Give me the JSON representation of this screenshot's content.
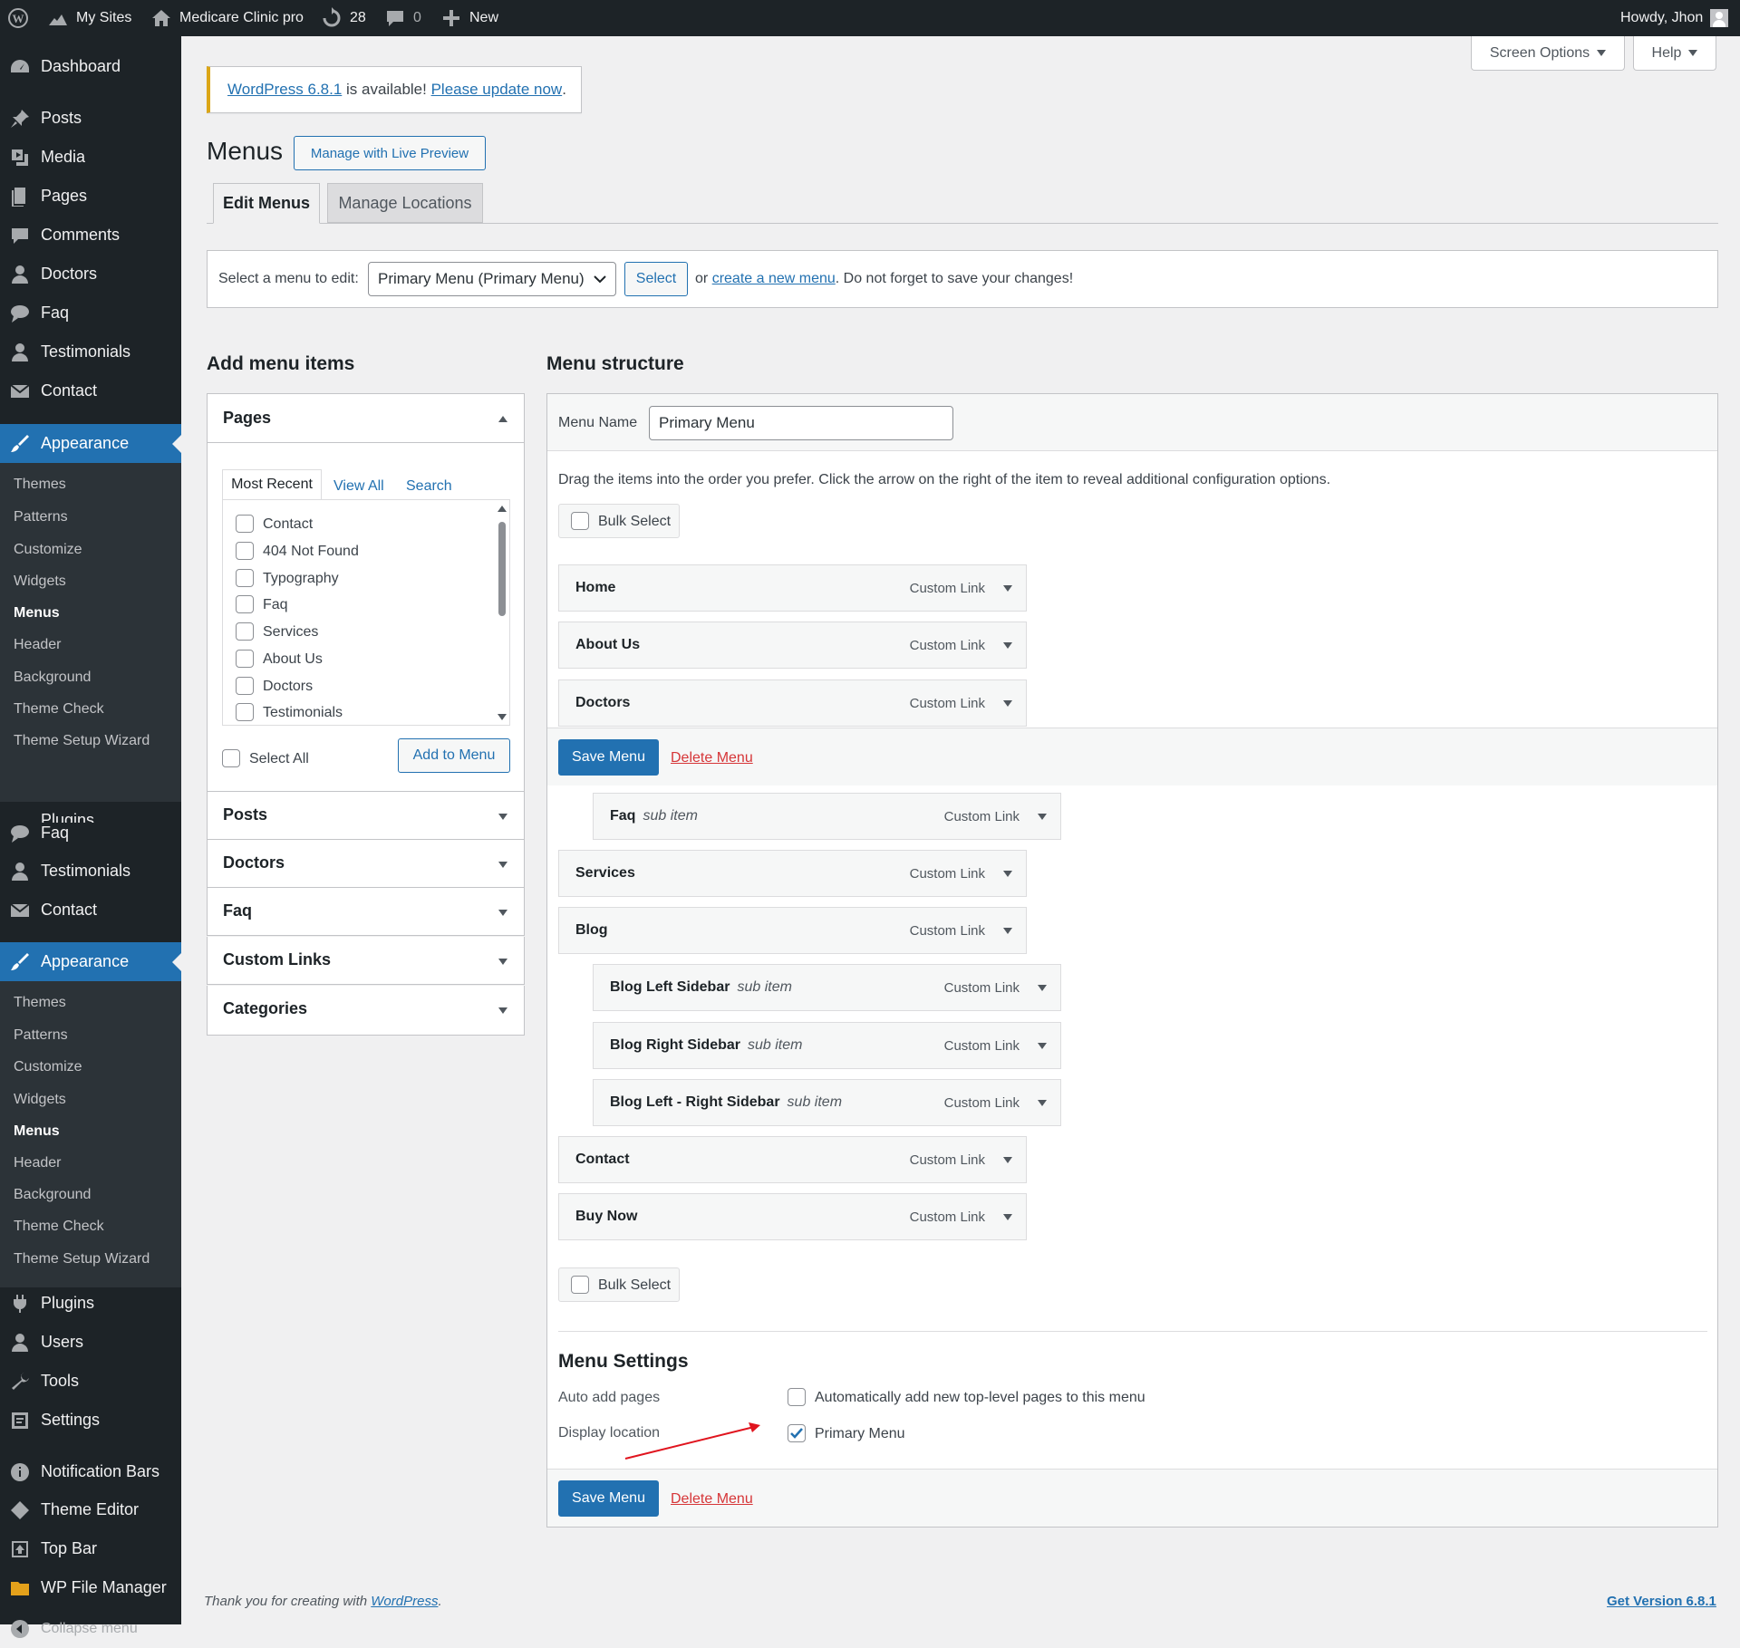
{
  "adminbar": {
    "my_sites": "My Sites",
    "site_name": "Medicare Clinic pro",
    "updates_count": "28",
    "comments_count": "0",
    "new_label": "New",
    "howdy": "Howdy, Jhon"
  },
  "sidebar": {
    "dashboard": "Dashboard",
    "posts": "Posts",
    "media": "Media",
    "pages": "Pages",
    "comments": "Comments",
    "doctors": "Doctors",
    "faq": "Faq",
    "testimonials": "Testimonials",
    "contact": "Contact",
    "appearance": "Appearance",
    "appearance_sub": [
      "Themes",
      "Patterns",
      "Customize",
      "Widgets",
      "Menus",
      "Header",
      "Background",
      "Theme Check",
      "Theme Setup Wizard"
    ],
    "plugins_cut": "Plugins",
    "faq2": "Faq",
    "testimonials2": "Testimonials",
    "contact2": "Contact",
    "appearance2": "Appearance",
    "plugins": "Plugins",
    "users": "Users",
    "tools": "Tools",
    "settings": "Settings",
    "notification_bars": "Notification Bars",
    "theme_editor": "Theme Editor",
    "top_bar": "Top Bar",
    "wp_file_manager": "WP File Manager",
    "collapse": "Collapse menu"
  },
  "screen_options": "Screen Options",
  "help": "Help",
  "notice": {
    "link1": "WordPress 6.8.1",
    "text": " is available! ",
    "link2": "Please update now",
    "end": "."
  },
  "page": {
    "title": "Menus",
    "live_preview": "Manage with Live Preview",
    "tab_edit": "Edit Menus",
    "tab_locations": "Manage Locations"
  },
  "select_bar": {
    "label": "Select a menu to edit:",
    "selected": "Primary Menu (Primary Menu)",
    "button": "Select",
    "or": "or",
    "create_link": "create a new menu",
    "suffix": ". Do not forget to save your changes!"
  },
  "add_items": {
    "heading": "Add menu items",
    "pages_title": "Pages",
    "tabs": [
      "Most Recent",
      "View All",
      "Search"
    ],
    "pages": [
      "Contact",
      "404 Not Found",
      "Typography",
      "Faq",
      "Services",
      "About Us",
      "Doctors",
      "Testimonials"
    ],
    "select_all": "Select All",
    "add_button": "Add to Menu",
    "sections": [
      "Posts",
      "Doctors",
      "Faq",
      "Custom Links",
      "Categories"
    ]
  },
  "structure": {
    "heading": "Menu structure",
    "menu_name_label": "Menu Name",
    "menu_name_value": "Primary Menu",
    "instructions": "Drag the items into the order you prefer. Click the arrow on the right of the item to reveal additional configuration options.",
    "bulk_select": "Bulk Select",
    "save": "Save Menu",
    "delete": "Delete Menu",
    "sub_item": "sub item",
    "items": [
      {
        "title": "Home",
        "type": "Custom Link"
      },
      {
        "title": "About Us",
        "type": "Custom Link"
      },
      {
        "title": "Doctors",
        "type": "Custom Link"
      },
      {
        "title": "Faq",
        "type": "Custom Link"
      },
      {
        "title": "Services",
        "type": "Custom Link"
      },
      {
        "title": "Blog",
        "type": "Custom Link"
      },
      {
        "title": "Blog Left Sidebar",
        "type": "Custom Link"
      },
      {
        "title": "Blog Right Sidebar",
        "type": "Custom Link"
      },
      {
        "title": "Blog Left - Right Sidebar",
        "type": "Custom Link"
      },
      {
        "title": "Contact",
        "type": "Custom Link"
      },
      {
        "title": "Buy Now",
        "type": "Custom Link"
      }
    ]
  },
  "settings": {
    "heading": "Menu Settings",
    "auto_add_label": "Auto add pages",
    "auto_add_text": "Automatically add new top-level pages to this menu",
    "display_label": "Display location",
    "primary_menu": "Primary Menu"
  },
  "footer": {
    "thanks": "Thank you for creating with ",
    "wp_link": "WordPress",
    "end": ".",
    "version": "Get Version 6.8.1"
  },
  "colors": {
    "admin_dark": "#1d2327",
    "accent": "#2271b1",
    "notice_border": "#dba617",
    "delete": "#d63638",
    "arrow": "#e0141e"
  }
}
